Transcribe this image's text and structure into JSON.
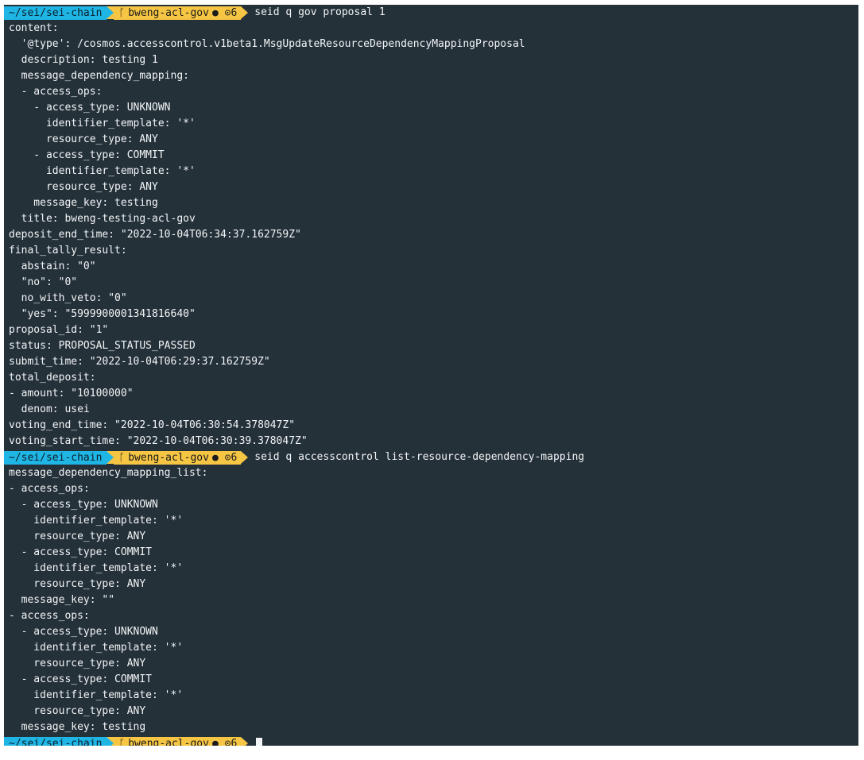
{
  "window": {
    "app": "Terminal"
  },
  "prompt": {
    "dir": "~/sei/sei-chain",
    "branch_icon": "git-branch-icon",
    "branch": "bweng-acl-gov",
    "status": "● ⊙6"
  },
  "blocks": [
    {
      "command": "seid q gov proposal 1",
      "output": [
        "content:",
        "  '@type': /cosmos.accesscontrol.v1beta1.MsgUpdateResourceDependencyMappingProposal",
        "  description: testing 1",
        "  message_dependency_mapping:",
        "  - access_ops:",
        "    - access_type: UNKNOWN",
        "      identifier_template: '*'",
        "      resource_type: ANY",
        "    - access_type: COMMIT",
        "      identifier_template: '*'",
        "      resource_type: ANY",
        "    message_key: testing",
        "  title: bweng-testing-acl-gov",
        "deposit_end_time: \"2022-10-04T06:34:37.162759Z\"",
        "final_tally_result:",
        "  abstain: \"0\"",
        "  \"no\": \"0\"",
        "  no_with_veto: \"0\"",
        "  \"yes\": \"5999900001341816640\"",
        "proposal_id: \"1\"",
        "status: PROPOSAL_STATUS_PASSED",
        "submit_time: \"2022-10-04T06:29:37.162759Z\"",
        "total_deposit:",
        "- amount: \"10100000\"",
        "  denom: usei",
        "voting_end_time: \"2022-10-04T06:30:54.378047Z\"",
        "voting_start_time: \"2022-10-04T06:30:39.378047Z\""
      ]
    },
    {
      "command": "seid q accesscontrol list-resource-dependency-mapping",
      "output": [
        "message_dependency_mapping_list:",
        "- access_ops:",
        "  - access_type: UNKNOWN",
        "    identifier_template: '*'",
        "    resource_type: ANY",
        "  - access_type: COMMIT",
        "    identifier_template: '*'",
        "    resource_type: ANY",
        "  message_key: \"\"",
        "- access_ops:",
        "  - access_type: UNKNOWN",
        "    identifier_template: '*'",
        "    resource_type: ANY",
        "  - access_type: COMMIT",
        "    identifier_template: '*'",
        "    resource_type: ANY",
        "  message_key: testing"
      ]
    },
    {
      "command": "",
      "output": [],
      "active": true
    }
  ],
  "colors": {
    "background": "#253139",
    "dir_segment": "#1fb6e6",
    "git_segment": "#f5c543",
    "text": "#f2f5f7"
  }
}
